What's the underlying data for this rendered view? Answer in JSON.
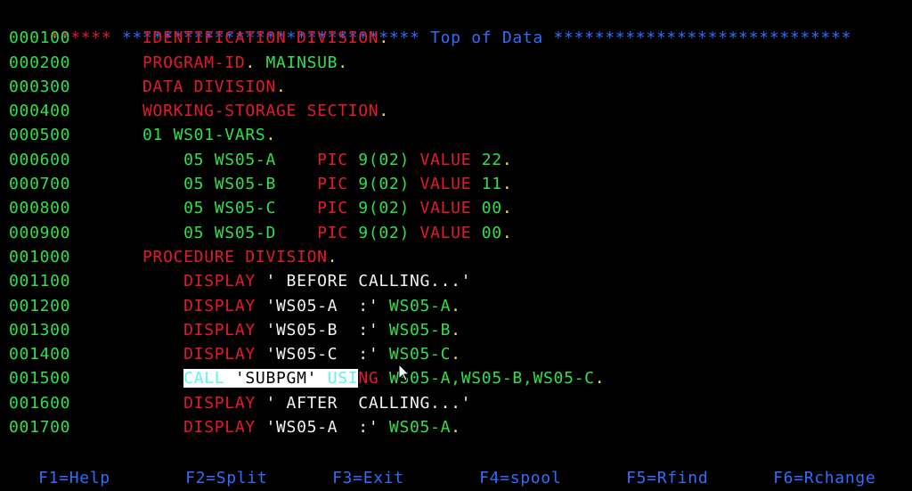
{
  "header": {
    "left_stars": "******",
    "middle_stars_left": "*****************************",
    "title": "Top of Data",
    "middle_stars_right": "*****************************"
  },
  "lines": [
    {
      "seq": "000100",
      "parts": [
        [
          "r",
          "IDENTIFICATION DIVISION"
        ],
        [
          "y",
          "."
        ]
      ]
    },
    {
      "seq": "000200",
      "parts": [
        [
          "r",
          "PROGRAM-ID"
        ],
        [
          "y",
          ". "
        ],
        [
          "g",
          "MAINSUB"
        ],
        [
          "y",
          "."
        ]
      ]
    },
    {
      "seq": "000300",
      "parts": [
        [
          "r",
          "DATA DIVISION"
        ],
        [
          "y",
          "."
        ]
      ]
    },
    {
      "seq": "000400",
      "parts": [
        [
          "r",
          "WORKING-STORAGE SECTION"
        ],
        [
          "y",
          "."
        ]
      ]
    },
    {
      "seq": "000500",
      "parts": [
        [
          "g",
          "01 WS01-VARS"
        ],
        [
          "y",
          "."
        ]
      ]
    },
    {
      "seq": "000600",
      "parts": [
        [
          "g",
          "    05 WS05-A    "
        ],
        [
          "r",
          "PIC "
        ],
        [
          "g",
          "9(02) "
        ],
        [
          "r",
          "VALUE "
        ],
        [
          "g",
          "22"
        ],
        [
          "y",
          "."
        ]
      ]
    },
    {
      "seq": "000700",
      "parts": [
        [
          "g",
          "    05 WS05-B    "
        ],
        [
          "r",
          "PIC "
        ],
        [
          "g",
          "9(02) "
        ],
        [
          "r",
          "VALUE "
        ],
        [
          "g",
          "11"
        ],
        [
          "y",
          "."
        ]
      ]
    },
    {
      "seq": "000800",
      "parts": [
        [
          "g",
          "    05 WS05-C    "
        ],
        [
          "r",
          "PIC "
        ],
        [
          "g",
          "9(02) "
        ],
        [
          "r",
          "VALUE "
        ],
        [
          "g",
          "00"
        ],
        [
          "y",
          "."
        ]
      ]
    },
    {
      "seq": "000900",
      "parts": [
        [
          "g",
          "    05 WS05-D    "
        ],
        [
          "r",
          "PIC "
        ],
        [
          "g",
          "9(02) "
        ],
        [
          "r",
          "VALUE "
        ],
        [
          "g",
          "00"
        ],
        [
          "y",
          "."
        ]
      ]
    },
    {
      "seq": "001000",
      "parts": [
        [
          "r",
          "PROCEDURE DIVISION"
        ],
        [
          "y",
          "."
        ]
      ]
    },
    {
      "seq": "001100",
      "parts": [
        [
          "r",
          "    DISPLAY "
        ],
        [
          "w",
          "' BEFORE CALLING...'"
        ]
      ]
    },
    {
      "seq": "001200",
      "parts": [
        [
          "r",
          "    DISPLAY "
        ],
        [
          "w",
          "'WS05-A  :' "
        ],
        [
          "g",
          "WS05-A"
        ],
        [
          "y",
          "."
        ]
      ]
    },
    {
      "seq": "001300",
      "parts": [
        [
          "r",
          "    DISPLAY "
        ],
        [
          "w",
          "'WS05-B  :' "
        ],
        [
          "g",
          "WS05-B"
        ],
        [
          "y",
          "."
        ]
      ]
    },
    {
      "seq": "001400",
      "parts": [
        [
          "r",
          "    DISPLAY "
        ],
        [
          "w",
          "'WS05-C  :' "
        ],
        [
          "g",
          "WS05-C"
        ],
        [
          "y",
          "."
        ]
      ]
    },
    {
      "seq": "001500",
      "parts": [
        [
          "g",
          "    "
        ],
        [
          "hl",
          "CALL 'SUBPGM' USI"
        ],
        [
          "r",
          "NG "
        ],
        [
          "g",
          "WS05-A,WS05-B,WS05-C"
        ],
        [
          "y",
          "."
        ]
      ]
    },
    {
      "seq": "001600",
      "parts": [
        [
          "r",
          "    DISPLAY "
        ],
        [
          "w",
          "' AFTER  CALLING...'"
        ]
      ]
    },
    {
      "seq": "001700",
      "parts": [
        [
          "r",
          "    DISPLAY "
        ],
        [
          "w",
          "'WS05-A  :' "
        ],
        [
          "g",
          "WS05-A"
        ],
        [
          "y",
          "."
        ]
      ]
    }
  ],
  "highlight": {
    "call": "CALL",
    "literal": "'SUBPGM'",
    "using_partial": "USI"
  },
  "function_keys": [
    "F1=Help",
    "F2=Split",
    "F3=Exit",
    "F4=spool",
    "F5=Rfind",
    "F6=Rchange"
  ],
  "colors": {
    "background": "#000000",
    "sequence": "#2fe04a",
    "keyword": "#e6192b",
    "identifier": "#2fe04a",
    "literal": "#f2f2f2",
    "period": "#f3e03a",
    "header": "#2f6dff",
    "function_keys": "#2f6dff",
    "highlight_keyword": "#5ff3f3"
  }
}
